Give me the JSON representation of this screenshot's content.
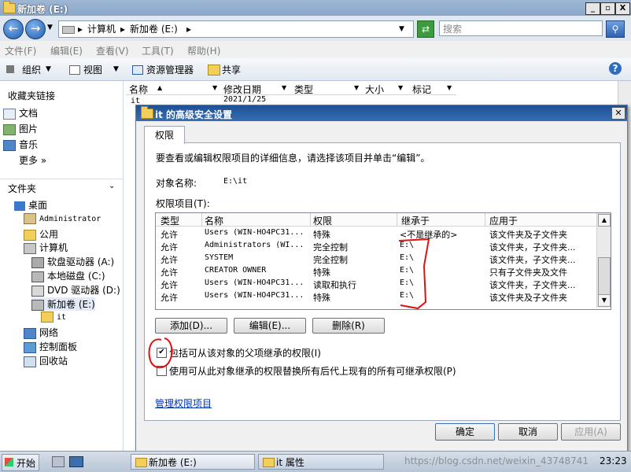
{
  "explorer": {
    "title": "新加卷 (E:)",
    "window_buttons": [
      "_",
      "▫",
      "X"
    ],
    "breadcrumb": [
      "计算机",
      "新加卷 (E:)"
    ],
    "search_placeholder": "搜索",
    "menu": [
      "文件(F)",
      "编辑(E)",
      "查看(V)",
      "工具(T)",
      "帮助(H)"
    ],
    "toolbar": {
      "organize": "组织",
      "view": "视图",
      "explorer": "资源管理器",
      "share": "共享"
    },
    "favorites": {
      "header": "收藏夹链接",
      "items": [
        "文档",
        "图片",
        "音乐"
      ],
      "more": "更多 »"
    },
    "folders": {
      "header": "文件夹",
      "tree": [
        {
          "label": "桌面"
        },
        {
          "label": "Administrator"
        },
        {
          "label": "公用"
        },
        {
          "label": "计算机"
        },
        {
          "label": "软盘驱动器 (A:)"
        },
        {
          "label": "本地磁盘 (C:)"
        },
        {
          "label": "DVD 驱动器 (D:)"
        },
        {
          "label": "新加卷 (E:)"
        },
        {
          "label": "it"
        },
        {
          "label": "网络"
        },
        {
          "label": "控制面板"
        },
        {
          "label": "回收站"
        }
      ]
    },
    "columns": [
      "名称",
      "修改日期",
      "类型",
      "大小",
      "标记"
    ],
    "file_row": {
      "name": "it",
      "date": "2021/1/25"
    }
  },
  "dialog": {
    "title": "it 的高级安全设置",
    "tab": "权限",
    "instruction": "要查看或编辑权限项目的详细信息，请选择该项目并单击“编辑”。",
    "object_label": "对象名称:",
    "object_value": "E:\\it",
    "entries_label": "权限项目(T):",
    "table": {
      "headers": [
        "类型",
        "名称",
        "权限",
        "继承于",
        "应用于"
      ],
      "rows": [
        [
          "允许",
          "Users (WIN-HO4PC31...",
          "特殊",
          "<不是继承的>",
          "该文件夹及子文件夹"
        ],
        [
          "允许",
          "Administrators (WI...",
          "完全控制",
          "E:\\",
          "该文件夹，子文件夹..."
        ],
        [
          "允许",
          "SYSTEM",
          "完全控制",
          "E:\\",
          "该文件夹，子文件夹..."
        ],
        [
          "允许",
          "CREATOR OWNER",
          "特殊",
          "E:\\",
          "只有子文件夹及文件"
        ],
        [
          "允许",
          "Users (WIN-HO4PC31...",
          "读取和执行",
          "E:\\",
          "该文件夹，子文件夹..."
        ],
        [
          "允许",
          "Users (WIN-HO4PC31...",
          "特殊",
          "E:\\",
          "该文件夹及子文件夹"
        ]
      ]
    },
    "buttons": {
      "add": "添加(D)...",
      "edit": "编辑(E)...",
      "remove": "删除(R)"
    },
    "checkbox_inherit": {
      "label": "包括可从该对象的父项继承的权限(I)",
      "checked": true
    },
    "checkbox_replace": {
      "label": "使用可从此对象继承的权限替换所有后代上现有的所有可继承权限(P)",
      "checked": false
    },
    "manage_link": "管理权限项目",
    "ok": "确定",
    "cancel": "取消",
    "apply": "应用(A)",
    "annotation_color": "#e01010"
  },
  "taskbar": {
    "start": "开始",
    "tasks": [
      "新加卷 (E:)",
      "it 属性"
    ],
    "watermark": "https://blog.csdn.net/weixin_43748741",
    "clock": "23:23"
  }
}
